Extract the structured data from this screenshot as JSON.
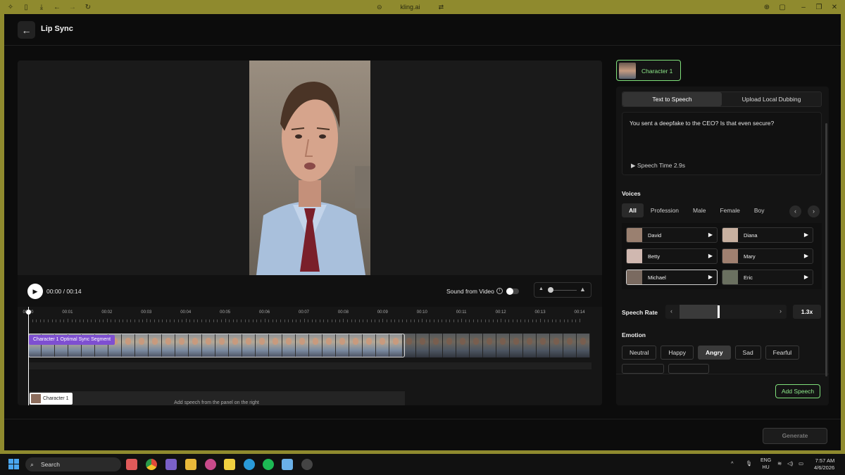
{
  "browser": {
    "url": "kling.ai"
  },
  "header": {
    "title": "Lip Sync"
  },
  "player": {
    "timecode": "00:00 / 00:14",
    "sound_label": "Sound from Video",
    "sound_enabled": false
  },
  "timeline": {
    "ticks": [
      "00:00",
      "00:01",
      "00:02",
      "00:03",
      "00:04",
      "00:05",
      "00:06",
      "00:07",
      "00:08",
      "00:09",
      "00:10",
      "00:11",
      "00:12",
      "00:13",
      "00:14"
    ],
    "segment_label": "Character 1 Optimal Sync Segment",
    "character_chip": "Character 1",
    "speech_hint": "Add speech from the panel on the right"
  },
  "panel": {
    "character_tab": "Character 1",
    "tabs": [
      "Text to Speech",
      "Upload Local Dubbing"
    ],
    "active_tab": "Text to Speech",
    "script_text": "You sent a deepfake to the CEO? Is that even secure?",
    "speech_time": "Speech Time 2.9s",
    "voices_title": "Voices",
    "filters": [
      "All",
      "Profession",
      "Male",
      "Female",
      "Boy"
    ],
    "active_filter": "All",
    "voices": [
      {
        "name": "David",
        "color": "#9a8070"
      },
      {
        "name": "Diana",
        "color": "#c8b0a0"
      },
      {
        "name": "Betty",
        "color": "#d0b8b0"
      },
      {
        "name": "Mary",
        "color": "#a08070"
      },
      {
        "name": "Michael",
        "color": "#7a6a60"
      },
      {
        "name": "Eric",
        "color": "#6a7060"
      }
    ],
    "selected_voice": "Michael",
    "speech_rate_label": "Speech Rate",
    "speech_rate_value": "1.3x",
    "emotion_title": "Emotion",
    "emotions": [
      "Neutral",
      "Happy",
      "Angry",
      "Sad",
      "Fearful"
    ],
    "active_emotion": "Angry",
    "add_speech": "Add Speech"
  },
  "footer": {
    "generate": "Generate"
  },
  "taskbar": {
    "search": "Search",
    "lang_top": "ENG",
    "lang_bottom": "HU",
    "time": "7:57 AM",
    "date": "4/6/2026"
  },
  "colors": {
    "accent_green": "#8ee98a",
    "segment_purple": "#7e4fd1"
  }
}
